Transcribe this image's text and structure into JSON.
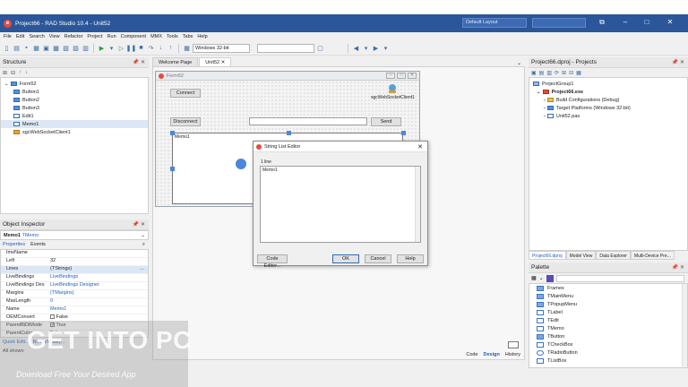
{
  "window": {
    "title": "Project66 - RAD Studio 10.4 - Unit52",
    "layout": "Default Layout"
  },
  "menu": [
    "File",
    "Edit",
    "Search",
    "View",
    "Refactor",
    "Project",
    "Run",
    "Component",
    "MMX",
    "Tools",
    "Tabs",
    "Help"
  ],
  "toolbar": {
    "platform": "Windows 32-bit"
  },
  "structure": {
    "title": "Structure",
    "tree": [
      "Form52",
      "Button1",
      "Button2",
      "Button3",
      "Edit1",
      "Memo1",
      "sgcWebSocketClient1"
    ]
  },
  "editor": {
    "tabs": [
      "Welcome Page",
      "Unit52"
    ],
    "form_caption": "Form52",
    "connect": "Connect",
    "disconnect": "Disconnect",
    "send": "Send",
    "memo": "Memo1",
    "ws_client": "sgcWebSocketClient1",
    "bottom_tabs": [
      "Code",
      "Design",
      "History"
    ]
  },
  "dialog": {
    "title": "String List Editor",
    "line_count": "1 line",
    "text": "Memo1",
    "code_editor": "Code Editor...",
    "ok": "OK",
    "cancel": "Cancel",
    "help": "Help"
  },
  "object_inspector": {
    "title": "Object Inspector",
    "selected_name": "Memo1",
    "selected_type": "TMemo",
    "tabs": [
      "Properties",
      "Events"
    ],
    "rows": [
      {
        "k": "ImeName",
        "v": ""
      },
      {
        "k": "Left",
        "v": "32"
      },
      {
        "k": "Lines",
        "v": "(TStrings)"
      },
      {
        "k": "LiveBindings",
        "v": "LiveBindings"
      },
      {
        "k": "LiveBindings Des",
        "v": "LiveBindings Designer"
      },
      {
        "k": "Margins",
        "v": "(TMargins)"
      },
      {
        "k": "MaxLength",
        "v": "0"
      },
      {
        "k": "Name",
        "v": "Memo1"
      },
      {
        "k": "OEMConvert",
        "v": "False"
      },
      {
        "k": "ParentBiDiMode",
        "v": "True"
      },
      {
        "k": "ParentColor",
        "v": "False"
      }
    ],
    "quick_edit": "Quick Edit...",
    "bind_visually": "Bind Visually...",
    "status": "All shown"
  },
  "projects": {
    "title": "Project66.dproj - Projects",
    "tree": [
      "ProjectGroup1",
      "Project66.exe",
      "Build Configurations (Debug)",
      "Target Platforms (Windows 32-bit)",
      "Unit52.pas"
    ],
    "tabs": [
      "Project66.dproj",
      "Model View",
      "Data Explorer",
      "Multi-Device Pre..."
    ]
  },
  "palette": {
    "title": "Palette",
    "items": [
      "Frames",
      "TMainMenu",
      "TPopupMenu",
      "TLabel",
      "TEdit",
      "TMemo",
      "TButton",
      "TCheckBox",
      "TRadioButton",
      "TListBox"
    ]
  },
  "watermark": {
    "text": "GET INTO PC",
    "sub": "Download Free Your Desired App"
  }
}
